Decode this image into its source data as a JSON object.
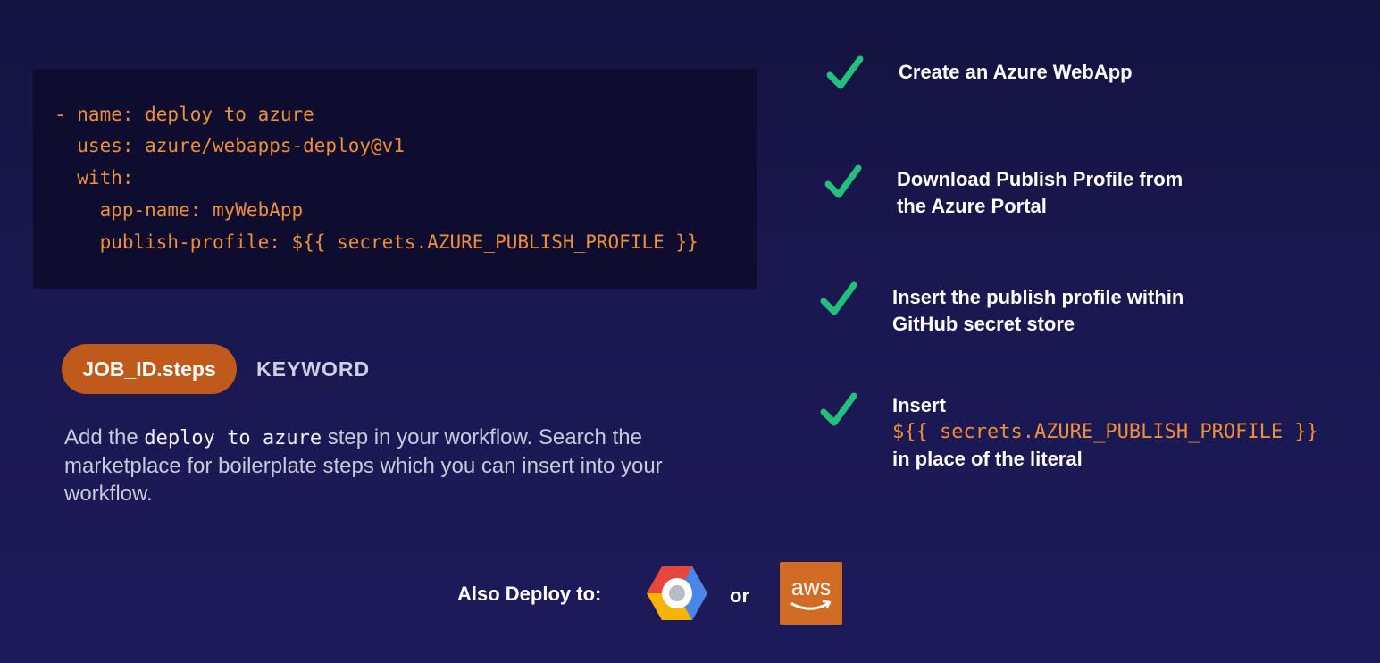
{
  "code": {
    "lines": [
      "- name: deploy to azure",
      "  uses: azure/webapps-deploy@v1",
      "  with:",
      "    app-name: myWebApp",
      "    publish-profile: ${{ secrets.AZURE_PUBLISH_PROFILE }}"
    ]
  },
  "pill_label": "JOB_ID.steps",
  "keyword_label": "KEYWORD",
  "description": {
    "pre": "Add the ",
    "code": "deploy to azure",
    "post": " step in your workflow. Search the marketplace for boilerplate steps which you can insert into your workflow."
  },
  "checklist": [
    {
      "line1": "Create an Azure WebApp"
    },
    {
      "line1": "Download Publish Profile from",
      "line2": "the Azure Portal"
    },
    {
      "line1": "Insert the publish profile within",
      "line2": "GitHub secret store"
    },
    {
      "line1": "Insert",
      "code": "${{ secrets.AZURE_PUBLISH_PROFILE }}",
      "line3": "in place of the literal"
    }
  ],
  "footer": {
    "also_label": "Also Deploy to:",
    "or_label": "or",
    "aws_label": "aws",
    "gcp_icon": "google-cloud-icon",
    "aws_icon": "aws-icon"
  },
  "colors": {
    "accent_orange": "#ee8f3a",
    "pill_bg": "#bf5a1c",
    "check_green": "#22c07a",
    "background": "#1a1850"
  }
}
